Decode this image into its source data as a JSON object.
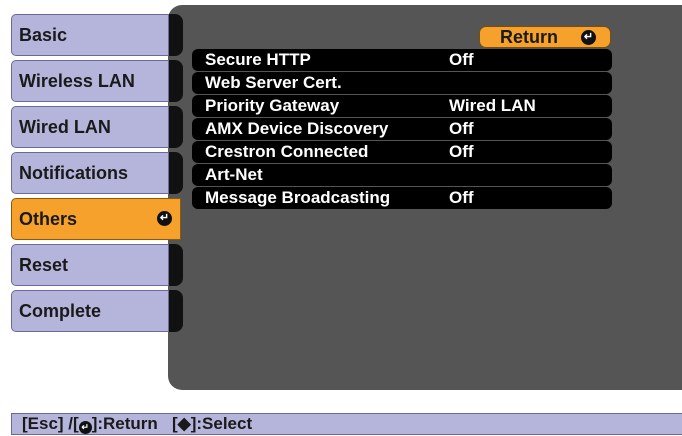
{
  "sidebar": {
    "items": [
      {
        "label": "Basic"
      },
      {
        "label": "Wireless LAN"
      },
      {
        "label": "Wired LAN"
      },
      {
        "label": "Notifications"
      },
      {
        "label": "Others"
      },
      {
        "label": "Reset"
      },
      {
        "label": "Complete"
      }
    ],
    "active": "Others"
  },
  "main": {
    "return_label": "Return",
    "rows": [
      {
        "label": "Secure HTTP",
        "value": "Off"
      },
      {
        "label": "Web Server Cert.",
        "value": ""
      },
      {
        "label": "Priority Gateway",
        "value": "Wired LAN"
      },
      {
        "label": "AMX Device Discovery",
        "value": "Off"
      },
      {
        "label": "Crestron Connected",
        "value": "Off"
      },
      {
        "label": "Art-Net",
        "value": ""
      },
      {
        "label": "Message Broadcasting",
        "value": "Off"
      }
    ]
  },
  "status_bar": {
    "esc": "[Esc] /[",
    "return": "]:Return",
    "select_open": "[",
    "select": "]:Select"
  },
  "icons": {
    "enter": "enter-icon",
    "updown": "up-down-icon"
  },
  "colors": {
    "accent": "#f5a12c",
    "tab": "#b5b5dc",
    "panel": "#555555",
    "row": "#000000"
  }
}
